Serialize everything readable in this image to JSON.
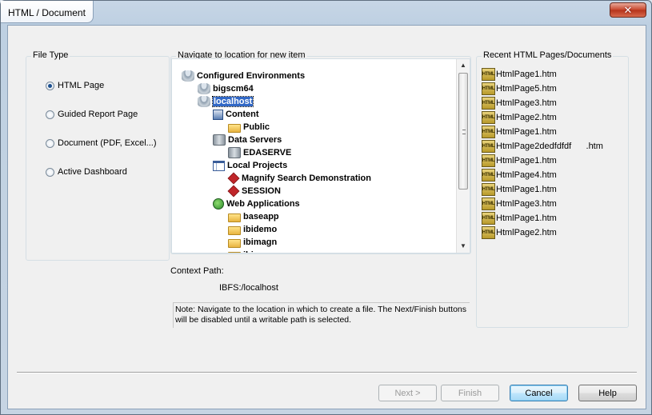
{
  "window": {
    "title": "HTML / Document",
    "close_label": "✕"
  },
  "file_type": {
    "label": "File Type",
    "options": [
      {
        "label": "HTML Page",
        "checked": true
      },
      {
        "label": "Guided Report Page",
        "checked": false
      },
      {
        "label": "Document (PDF, Excel...)",
        "checked": false
      },
      {
        "label": "Active Dashboard",
        "checked": false
      }
    ]
  },
  "navigate": {
    "label": "Navigate to location for new item",
    "tree": [
      {
        "label": "Configured Environments",
        "icon": "database-icon",
        "level": 0
      },
      {
        "label": "bigscm64",
        "icon": "database-icon",
        "level": 1
      },
      {
        "label": "localhost",
        "icon": "database-icon",
        "level": 1,
        "selected": true
      },
      {
        "label": "Content",
        "icon": "content-icon",
        "level": 2
      },
      {
        "label": "Public",
        "icon": "folder-icon",
        "level": 3
      },
      {
        "label": "Data Servers",
        "icon": "server-icon",
        "level": 2
      },
      {
        "label": "EDASERVE",
        "icon": "server-icon",
        "level": 3
      },
      {
        "label": "Local Projects",
        "icon": "project-icon",
        "level": 2
      },
      {
        "label": "Magnify Search Demonstration",
        "icon": "magnify-icon",
        "level": 3
      },
      {
        "label": "SESSION",
        "icon": "magnify-icon",
        "level": 3
      },
      {
        "label": "Web Applications",
        "icon": "web-app-icon",
        "level": 2
      },
      {
        "label": "baseapp",
        "icon": "folder-icon",
        "level": 3
      },
      {
        "label": "ibidemo",
        "icon": "folder-icon",
        "level": 3
      },
      {
        "label": "ibimagn",
        "icon": "folder-icon",
        "level": 3
      },
      {
        "label": "ibiapps",
        "icon": "folder-icon",
        "level": 3
      }
    ]
  },
  "context": {
    "label": "Context Path:",
    "value": "IBFS:/localhost"
  },
  "note": "Note: Navigate to the location in which  to create a file. The Next/Finish buttons will be disabled until a writable path is selected.",
  "recent": {
    "label": "Recent HTML Pages/Documents",
    "icon_text": "HTML",
    "items": [
      "HtmlPage1.htm",
      "HtmlPage5.htm",
      "HtmlPage3.htm",
      "HtmlPage2.htm",
      "HtmlPage1.htm",
      "HtmlPage2dedfdfdf      .htm",
      "HtmlPage1.htm",
      "HtmlPage4.htm",
      "HtmlPage1.htm",
      "HtmlPage3.htm",
      "HtmlPage1.htm",
      "HtmlPage2.htm"
    ]
  },
  "buttons": {
    "next": "Next >",
    "finish": "Finish",
    "cancel": "Cancel",
    "help": "Help"
  }
}
